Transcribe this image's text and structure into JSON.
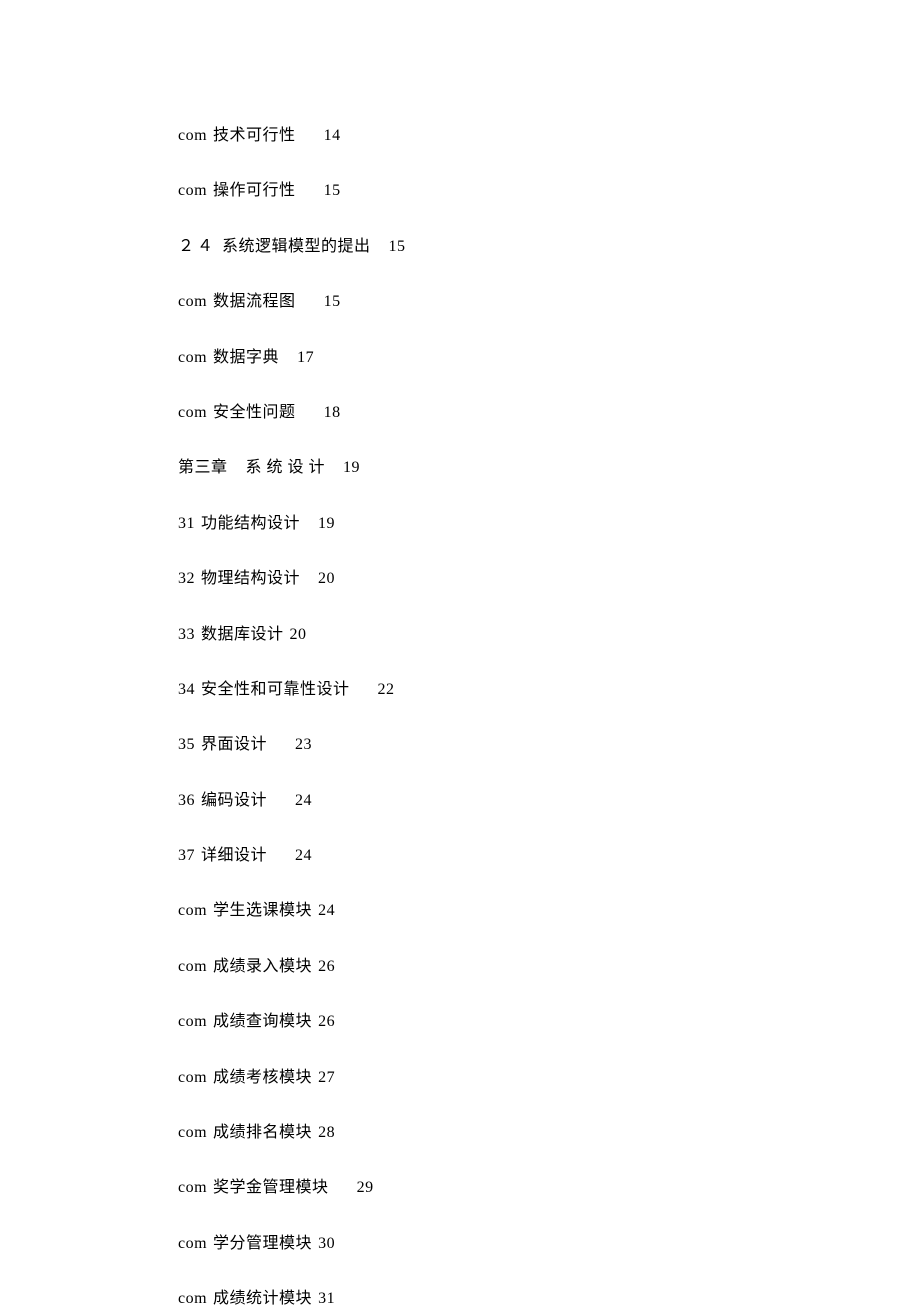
{
  "toc": [
    {
      "prefix": "com",
      "title": "技术可行性",
      "page": "14",
      "gap": "med"
    },
    {
      "prefix": "com",
      "title": "操作可行性",
      "page": "15",
      "gap": "med"
    },
    {
      "prefix": "２４",
      "title": "系统逻辑模型的提出",
      "page": "15",
      "gap": "small",
      "prefixSpaced": true
    },
    {
      "prefix": "com",
      "title": "数据流程图",
      "page": "15",
      "gap": "med"
    },
    {
      "prefix": "com",
      "title": "数据字典",
      "page": "17",
      "gap": "small"
    },
    {
      "prefix": "com",
      "title": "安全性问题",
      "page": "18",
      "gap": "med"
    },
    {
      "prefix": "第三章",
      "title": "系 统 设 计",
      "page": "19",
      "gap": "small",
      "prefixSpaced": false,
      "extraPrefixGap": true
    },
    {
      "prefix": "31",
      "title": "功能结构设计",
      "page": "19",
      "gap": "small"
    },
    {
      "prefix": "32",
      "title": "物理结构设计",
      "page": "20",
      "gap": "small"
    },
    {
      "prefix": "33",
      "title": "数据库设计",
      "page": "20",
      "gap": "none"
    },
    {
      "prefix": "34",
      "title": "安全性和可靠性设计",
      "page": "22",
      "gap": "med"
    },
    {
      "prefix": "35",
      "title": "界面设计",
      "page": "23",
      "gap": "med"
    },
    {
      "prefix": "36",
      "title": "编码设计",
      "page": "24",
      "gap": "med"
    },
    {
      "prefix": "37",
      "title": "详细设计",
      "page": "24",
      "gap": "med"
    },
    {
      "prefix": "com",
      "title": "学生选课模块",
      "page": "24",
      "gap": "none"
    },
    {
      "prefix": "com",
      "title": "成绩录入模块",
      "page": "26",
      "gap": "none"
    },
    {
      "prefix": "com",
      "title": "成绩查询模块",
      "page": "26",
      "gap": "none"
    },
    {
      "prefix": "com",
      "title": "成绩考核模块",
      "page": "27",
      "gap": "none"
    },
    {
      "prefix": "com",
      "title": "成绩排名模块",
      "page": "28",
      "gap": "none"
    },
    {
      "prefix": "com",
      "title": "奖学金管理模块",
      "page": "29",
      "gap": "med"
    },
    {
      "prefix": "com",
      "title": "学分管理模块",
      "page": "30",
      "gap": "none"
    },
    {
      "prefix": "com",
      "title": "成绩统计模块",
      "page": "31",
      "gap": "none"
    }
  ]
}
